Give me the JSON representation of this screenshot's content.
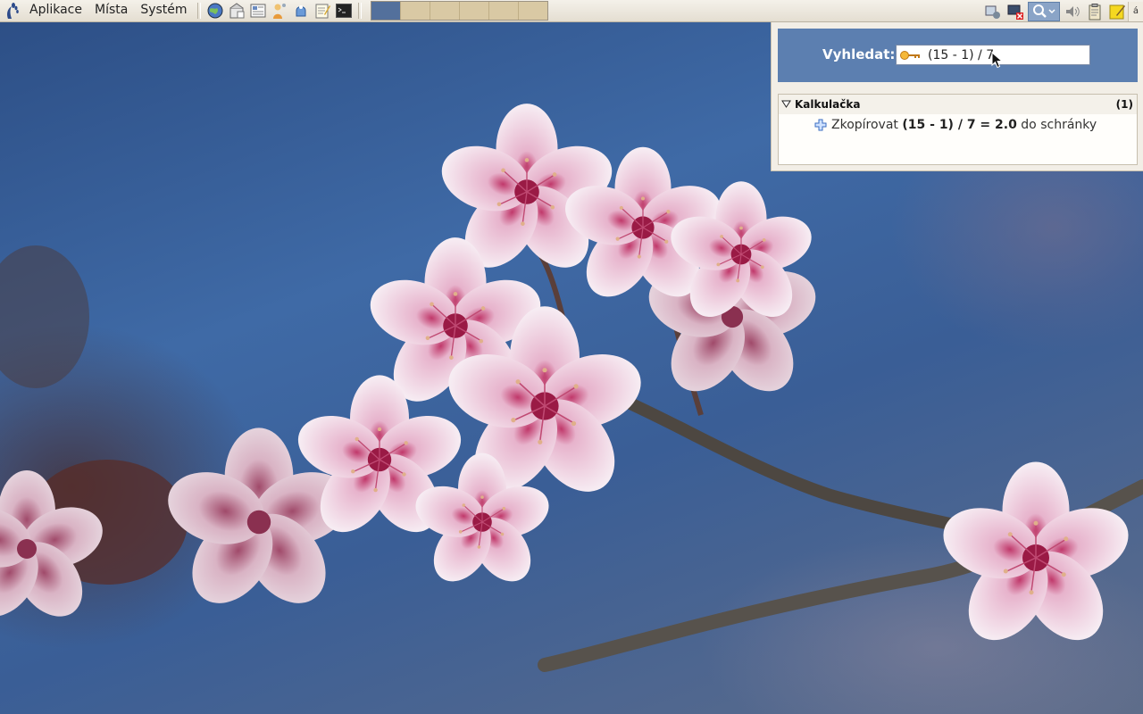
{
  "top_panel": {
    "menus": [
      "Aplikace",
      "Místa",
      "Systém"
    ],
    "launchers": [
      "web-browser-icon",
      "mail-client-icon",
      "news-reader-icon",
      "people-icon",
      "help-icon",
      "text-editor-icon",
      "terminal-icon"
    ],
    "workspaces": {
      "count": 6,
      "active_index": 0
    },
    "tray": [
      "network-icon",
      "display-disconnect-icon",
      "search-icon",
      "volume-icon",
      "clipboard-icon",
      "notes-icon"
    ],
    "corner_label": "á"
  },
  "search": {
    "label": "Vyhledat:",
    "query": "(15 - 1) / 7",
    "category": {
      "name": "Kalkulačka",
      "count": "(1)"
    },
    "result": {
      "prefix": "Zkopírovat",
      "expression": "(15 - 1) / 7 = 2.0",
      "suffix": "do schránky"
    }
  },
  "colors": {
    "panel": "#ece7dc",
    "search_header": "#5c7fb0",
    "workspace_active": "#53709c",
    "workspace_inactive": "#d9c9a4"
  }
}
